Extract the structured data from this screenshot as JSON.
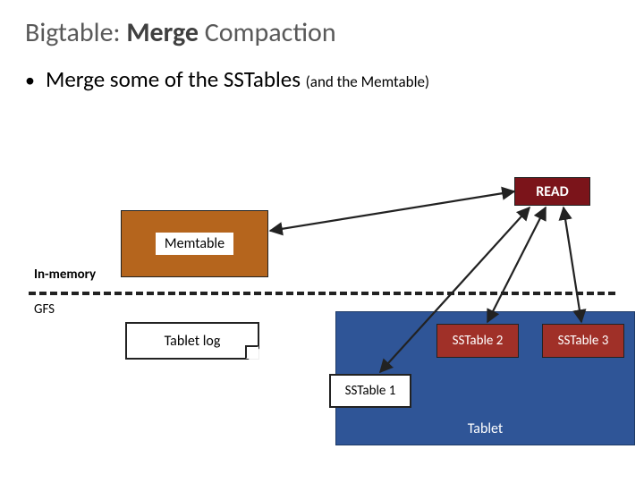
{
  "title": {
    "prefix": "Bigtable: ",
    "bold": "Merge",
    "suffix": " Compaction"
  },
  "bullet": {
    "main": "Merge some of the SSTables ",
    "sub": "(and the Memtable)"
  },
  "labels": {
    "memtable": "Memtable",
    "read": "READ",
    "in_memory": "In-memory",
    "gfs": "GFS",
    "tablet_log": "Tablet log",
    "tablet": "Tablet",
    "sstable1": "SSTable 1",
    "sstable2": "SSTable 2",
    "sstable3": "SSTable 3"
  },
  "colors": {
    "memtable_bg": "#b5651d",
    "read_bg": "#7b141a",
    "tablet_bg": "#2f5597",
    "sstable_bg": "#a03028"
  }
}
